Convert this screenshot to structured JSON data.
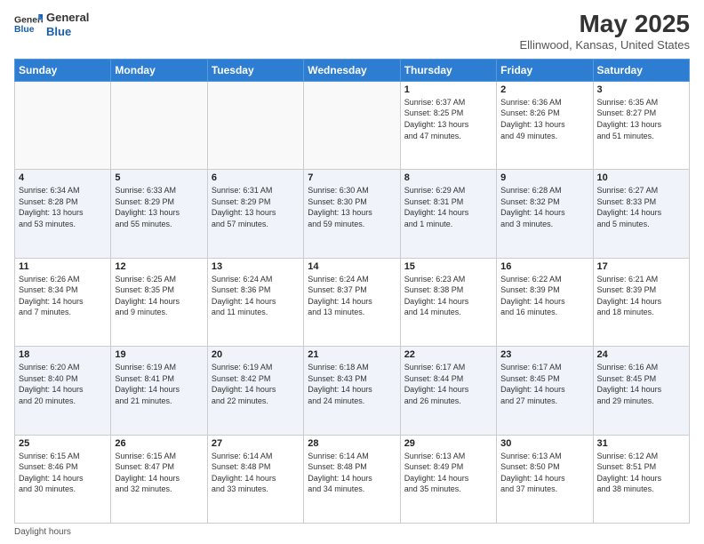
{
  "header": {
    "logo_line1": "General",
    "logo_line2": "Blue",
    "title": "May 2025",
    "subtitle": "Ellinwood, Kansas, United States"
  },
  "days_of_week": [
    "Sunday",
    "Monday",
    "Tuesday",
    "Wednesday",
    "Thursday",
    "Friday",
    "Saturday"
  ],
  "footer": {
    "daylight_label": "Daylight hours"
  },
  "weeks": [
    [
      {
        "day": "",
        "info": ""
      },
      {
        "day": "",
        "info": ""
      },
      {
        "day": "",
        "info": ""
      },
      {
        "day": "",
        "info": ""
      },
      {
        "day": "1",
        "info": "Sunrise: 6:37 AM\nSunset: 8:25 PM\nDaylight: 13 hours\nand 47 minutes."
      },
      {
        "day": "2",
        "info": "Sunrise: 6:36 AM\nSunset: 8:26 PM\nDaylight: 13 hours\nand 49 minutes."
      },
      {
        "day": "3",
        "info": "Sunrise: 6:35 AM\nSunset: 8:27 PM\nDaylight: 13 hours\nand 51 minutes."
      }
    ],
    [
      {
        "day": "4",
        "info": "Sunrise: 6:34 AM\nSunset: 8:28 PM\nDaylight: 13 hours\nand 53 minutes."
      },
      {
        "day": "5",
        "info": "Sunrise: 6:33 AM\nSunset: 8:29 PM\nDaylight: 13 hours\nand 55 minutes."
      },
      {
        "day": "6",
        "info": "Sunrise: 6:31 AM\nSunset: 8:29 PM\nDaylight: 13 hours\nand 57 minutes."
      },
      {
        "day": "7",
        "info": "Sunrise: 6:30 AM\nSunset: 8:30 PM\nDaylight: 13 hours\nand 59 minutes."
      },
      {
        "day": "8",
        "info": "Sunrise: 6:29 AM\nSunset: 8:31 PM\nDaylight: 14 hours\nand 1 minute."
      },
      {
        "day": "9",
        "info": "Sunrise: 6:28 AM\nSunset: 8:32 PM\nDaylight: 14 hours\nand 3 minutes."
      },
      {
        "day": "10",
        "info": "Sunrise: 6:27 AM\nSunset: 8:33 PM\nDaylight: 14 hours\nand 5 minutes."
      }
    ],
    [
      {
        "day": "11",
        "info": "Sunrise: 6:26 AM\nSunset: 8:34 PM\nDaylight: 14 hours\nand 7 minutes."
      },
      {
        "day": "12",
        "info": "Sunrise: 6:25 AM\nSunset: 8:35 PM\nDaylight: 14 hours\nand 9 minutes."
      },
      {
        "day": "13",
        "info": "Sunrise: 6:24 AM\nSunset: 8:36 PM\nDaylight: 14 hours\nand 11 minutes."
      },
      {
        "day": "14",
        "info": "Sunrise: 6:24 AM\nSunset: 8:37 PM\nDaylight: 14 hours\nand 13 minutes."
      },
      {
        "day": "15",
        "info": "Sunrise: 6:23 AM\nSunset: 8:38 PM\nDaylight: 14 hours\nand 14 minutes."
      },
      {
        "day": "16",
        "info": "Sunrise: 6:22 AM\nSunset: 8:39 PM\nDaylight: 14 hours\nand 16 minutes."
      },
      {
        "day": "17",
        "info": "Sunrise: 6:21 AM\nSunset: 8:39 PM\nDaylight: 14 hours\nand 18 minutes."
      }
    ],
    [
      {
        "day": "18",
        "info": "Sunrise: 6:20 AM\nSunset: 8:40 PM\nDaylight: 14 hours\nand 20 minutes."
      },
      {
        "day": "19",
        "info": "Sunrise: 6:19 AM\nSunset: 8:41 PM\nDaylight: 14 hours\nand 21 minutes."
      },
      {
        "day": "20",
        "info": "Sunrise: 6:19 AM\nSunset: 8:42 PM\nDaylight: 14 hours\nand 22 minutes."
      },
      {
        "day": "21",
        "info": "Sunrise: 6:18 AM\nSunset: 8:43 PM\nDaylight: 14 hours\nand 24 minutes."
      },
      {
        "day": "22",
        "info": "Sunrise: 6:17 AM\nSunset: 8:44 PM\nDaylight: 14 hours\nand 26 minutes."
      },
      {
        "day": "23",
        "info": "Sunrise: 6:17 AM\nSunset: 8:45 PM\nDaylight: 14 hours\nand 27 minutes."
      },
      {
        "day": "24",
        "info": "Sunrise: 6:16 AM\nSunset: 8:45 PM\nDaylight: 14 hours\nand 29 minutes."
      }
    ],
    [
      {
        "day": "25",
        "info": "Sunrise: 6:15 AM\nSunset: 8:46 PM\nDaylight: 14 hours\nand 30 minutes."
      },
      {
        "day": "26",
        "info": "Sunrise: 6:15 AM\nSunset: 8:47 PM\nDaylight: 14 hours\nand 32 minutes."
      },
      {
        "day": "27",
        "info": "Sunrise: 6:14 AM\nSunset: 8:48 PM\nDaylight: 14 hours\nand 33 minutes."
      },
      {
        "day": "28",
        "info": "Sunrise: 6:14 AM\nSunset: 8:48 PM\nDaylight: 14 hours\nand 34 minutes."
      },
      {
        "day": "29",
        "info": "Sunrise: 6:13 AM\nSunset: 8:49 PM\nDaylight: 14 hours\nand 35 minutes."
      },
      {
        "day": "30",
        "info": "Sunrise: 6:13 AM\nSunset: 8:50 PM\nDaylight: 14 hours\nand 37 minutes."
      },
      {
        "day": "31",
        "info": "Sunrise: 6:12 AM\nSunset: 8:51 PM\nDaylight: 14 hours\nand 38 minutes."
      }
    ]
  ]
}
